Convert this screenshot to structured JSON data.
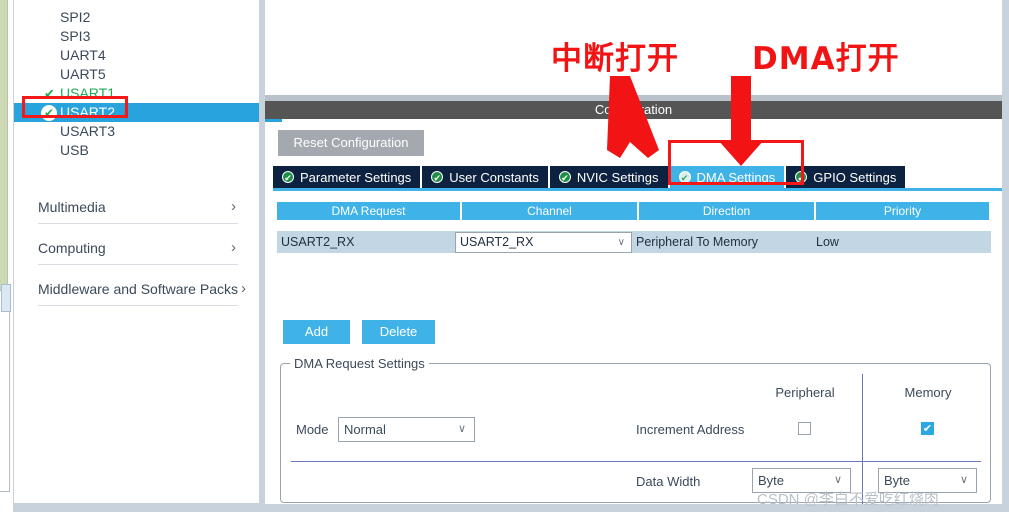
{
  "sidebar": {
    "peripherals": [
      {
        "label": "SPI2",
        "state": "none"
      },
      {
        "label": "SPI3",
        "state": "none"
      },
      {
        "label": "UART4",
        "state": "none"
      },
      {
        "label": "UART5",
        "state": "none"
      },
      {
        "label": "USART1",
        "state": "enabled"
      },
      {
        "label": "USART2",
        "state": "selected"
      },
      {
        "label": "USART3",
        "state": "none"
      },
      {
        "label": "USB",
        "state": "none"
      }
    ],
    "check_glyph": "✔",
    "categories": [
      {
        "label": "Multimedia",
        "chevron": "›"
      },
      {
        "label": "Computing",
        "chevron": "›"
      },
      {
        "label": "Middleware and Software Packs",
        "chevron": "›"
      }
    ]
  },
  "panel": {
    "title": "Configuration",
    "reset_label": "Reset Configuration",
    "tabs": [
      {
        "label": "Parameter Settings",
        "active": false
      },
      {
        "label": "User Constants",
        "active": false
      },
      {
        "label": "NVIC Settings",
        "active": false
      },
      {
        "label": "DMA Settings",
        "active": true
      },
      {
        "label": "GPIO Settings",
        "active": false
      }
    ],
    "tab_icon": "✔"
  },
  "dma_table": {
    "headers": [
      "DMA Request",
      "Channel",
      "Direction",
      "Priority"
    ],
    "rows": [
      {
        "request": "USART2_RX",
        "channel": "USART2_RX",
        "direction": "Peripheral To Memory",
        "priority": "Low"
      }
    ],
    "chevron": "∨"
  },
  "buttons": {
    "add": "Add",
    "delete": "Delete"
  },
  "request_settings": {
    "legend": "DMA Request Settings",
    "col_peripheral": "Peripheral",
    "col_memory": "Memory",
    "mode_label": "Mode",
    "mode_value": "Normal",
    "increment_label": "Increment Address",
    "increment_peripheral_checked": false,
    "increment_memory_checked": true,
    "check_glyph": "✔",
    "data_width_label": "Data Width",
    "data_width_peripheral": "Byte",
    "data_width_memory": "Byte",
    "chevron": "∨"
  },
  "annotations": {
    "interrupt_open": "中断打开",
    "dma_open": "DMA打开"
  },
  "watermark": "CSDN @李白不爱吃红烧肉",
  "colors": {
    "accent_blue": "#3fb3e8",
    "tab_navy": "#0d2240",
    "annotation_red": "#f21414",
    "enabled_green": "#1faa56",
    "selected_row": "#29a3dc"
  }
}
